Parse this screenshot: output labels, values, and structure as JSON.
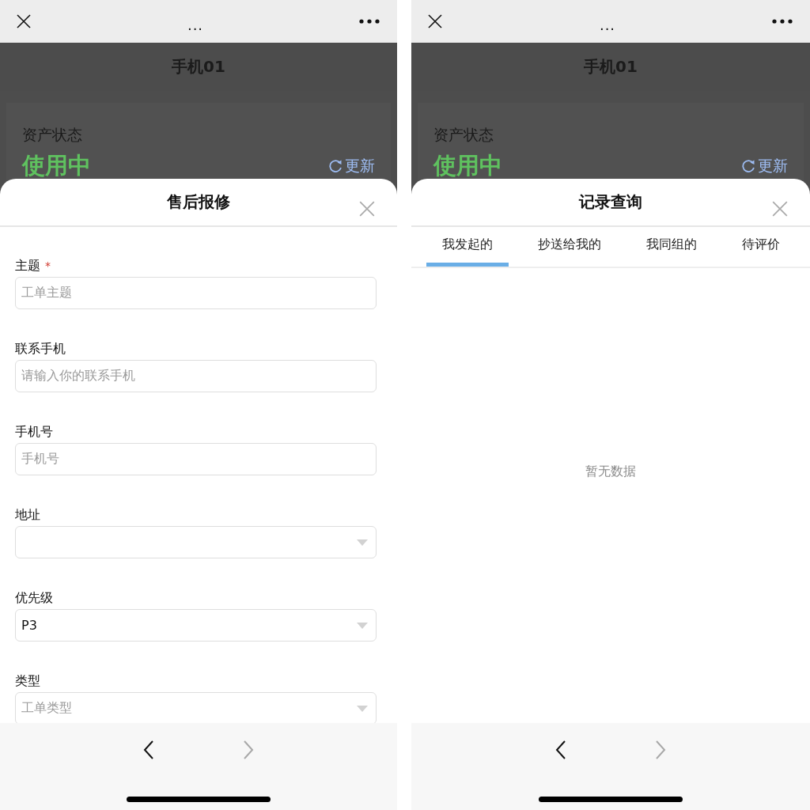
{
  "phones": [
    {
      "top_bar": {
        "title": "..."
      },
      "page": {
        "title": "手机01",
        "status_label": "资产状态",
        "status_value": "使用中",
        "refresh": "更新"
      },
      "sheet": {
        "kind": "form",
        "title": "售后报修",
        "fields": [
          {
            "kind": "text",
            "label": "主题",
            "required_mark": "*",
            "placeholder": "工单主题"
          },
          {
            "kind": "text",
            "label": "联系手机",
            "placeholder": "请输入你的联系手机"
          },
          {
            "kind": "text",
            "label": "手机号",
            "placeholder": "手机号"
          },
          {
            "kind": "select",
            "label": "地址"
          },
          {
            "kind": "select",
            "label": "优先级",
            "value": "P3"
          },
          {
            "kind": "select",
            "label": "类型",
            "placeholder": "工单类型"
          }
        ]
      },
      "nav": {
        "back_disabled": false,
        "forward_disabled": true
      }
    },
    {
      "top_bar": {
        "title": "..."
      },
      "page": {
        "title": "手机01",
        "status_label": "资产状态",
        "status_value": "使用中",
        "refresh": "更新"
      },
      "sheet": {
        "kind": "tabs",
        "title": "记录查询",
        "tabs": [
          {
            "label": "我发起的",
            "selected": true
          },
          {
            "label": "抄送给我的",
            "selected": false
          },
          {
            "label": "我同组的",
            "selected": false
          },
          {
            "label": "待评价",
            "selected": false
          }
        ],
        "empty_text": "暂无数据"
      },
      "nav": {
        "back_disabled": false,
        "forward_disabled": true
      }
    }
  ]
}
